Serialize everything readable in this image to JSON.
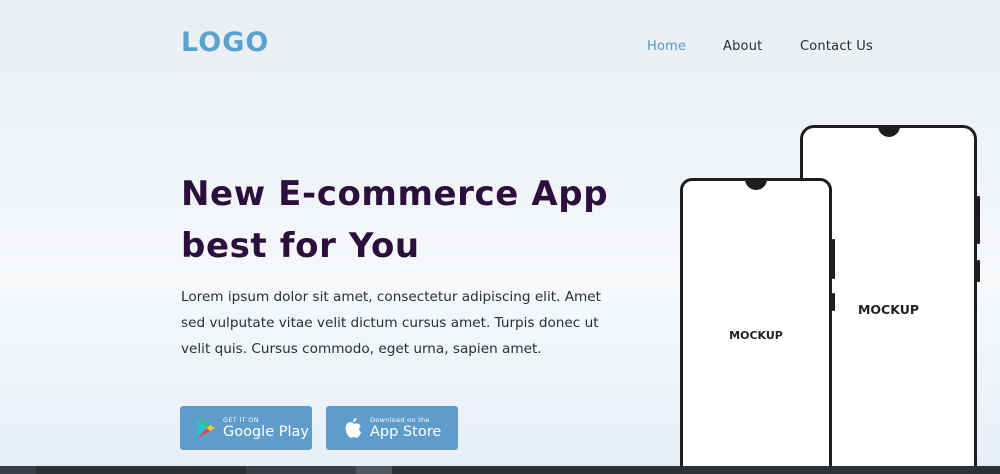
{
  "header": {
    "logo": "LOGO",
    "nav": [
      "Home",
      "About",
      "Contact Us"
    ],
    "active_nav": "Home"
  },
  "hero": {
    "title_lines": [
      "New E-commerce App",
      "best for You"
    ],
    "text_lines": [
      "Lorem ipsum dolor sit amet, consectetur adipiscing elit. Amet",
      "sed vulputate vitae velit dictum cursus amet. Turpis donec ut",
      "velit quis. Cursus commodo, eget urna, sapien amet."
    ]
  },
  "store_buttons": {
    "google_play": {
      "small": "GET IT ON",
      "big": "Google Play",
      "icon": "google-play-icon"
    },
    "app_store": {
      "small": "Download on the",
      "big": "App Store",
      "icon": "apple-icon"
    }
  },
  "phones": {
    "back_label": "MOCKUP",
    "front_label": "MOCKUP"
  },
  "colors": {
    "accent": "#5aa2d0",
    "title": "#2b0f3d",
    "button": "#5e9ccb"
  }
}
